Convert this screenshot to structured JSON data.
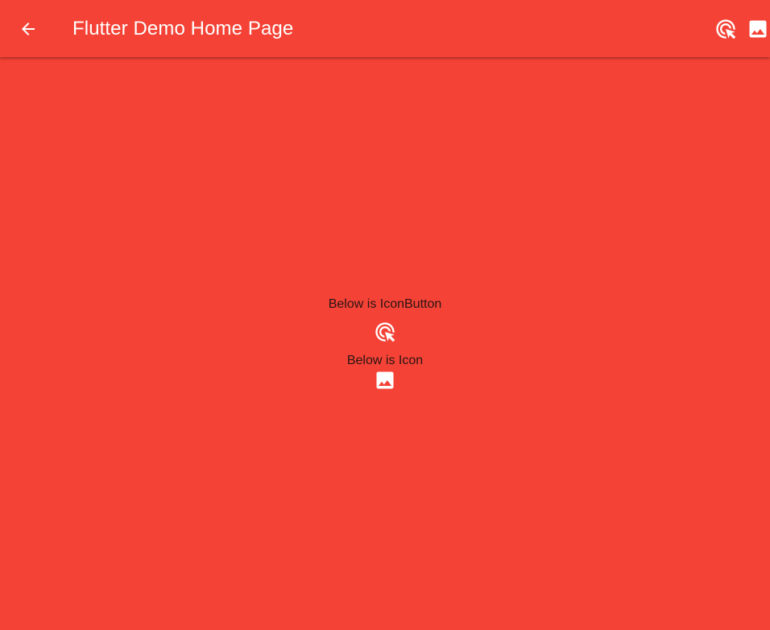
{
  "app_bar": {
    "title": "Flutter Demo Home Page",
    "back_icon": "arrow-back-icon",
    "actions": [
      {
        "icon": "ads-click-icon"
      },
      {
        "icon": "image-icon"
      }
    ]
  },
  "body": {
    "icon_button_label": "Below is IconButton",
    "icon_button_icon": "ads-click-icon",
    "icon_label": "Below is Icon",
    "icon_icon": "image-icon"
  },
  "colors": {
    "background": "#F44336",
    "app_bar": "#F44336",
    "foreground": "#FFFFFF",
    "body_text": "#2A1414"
  }
}
